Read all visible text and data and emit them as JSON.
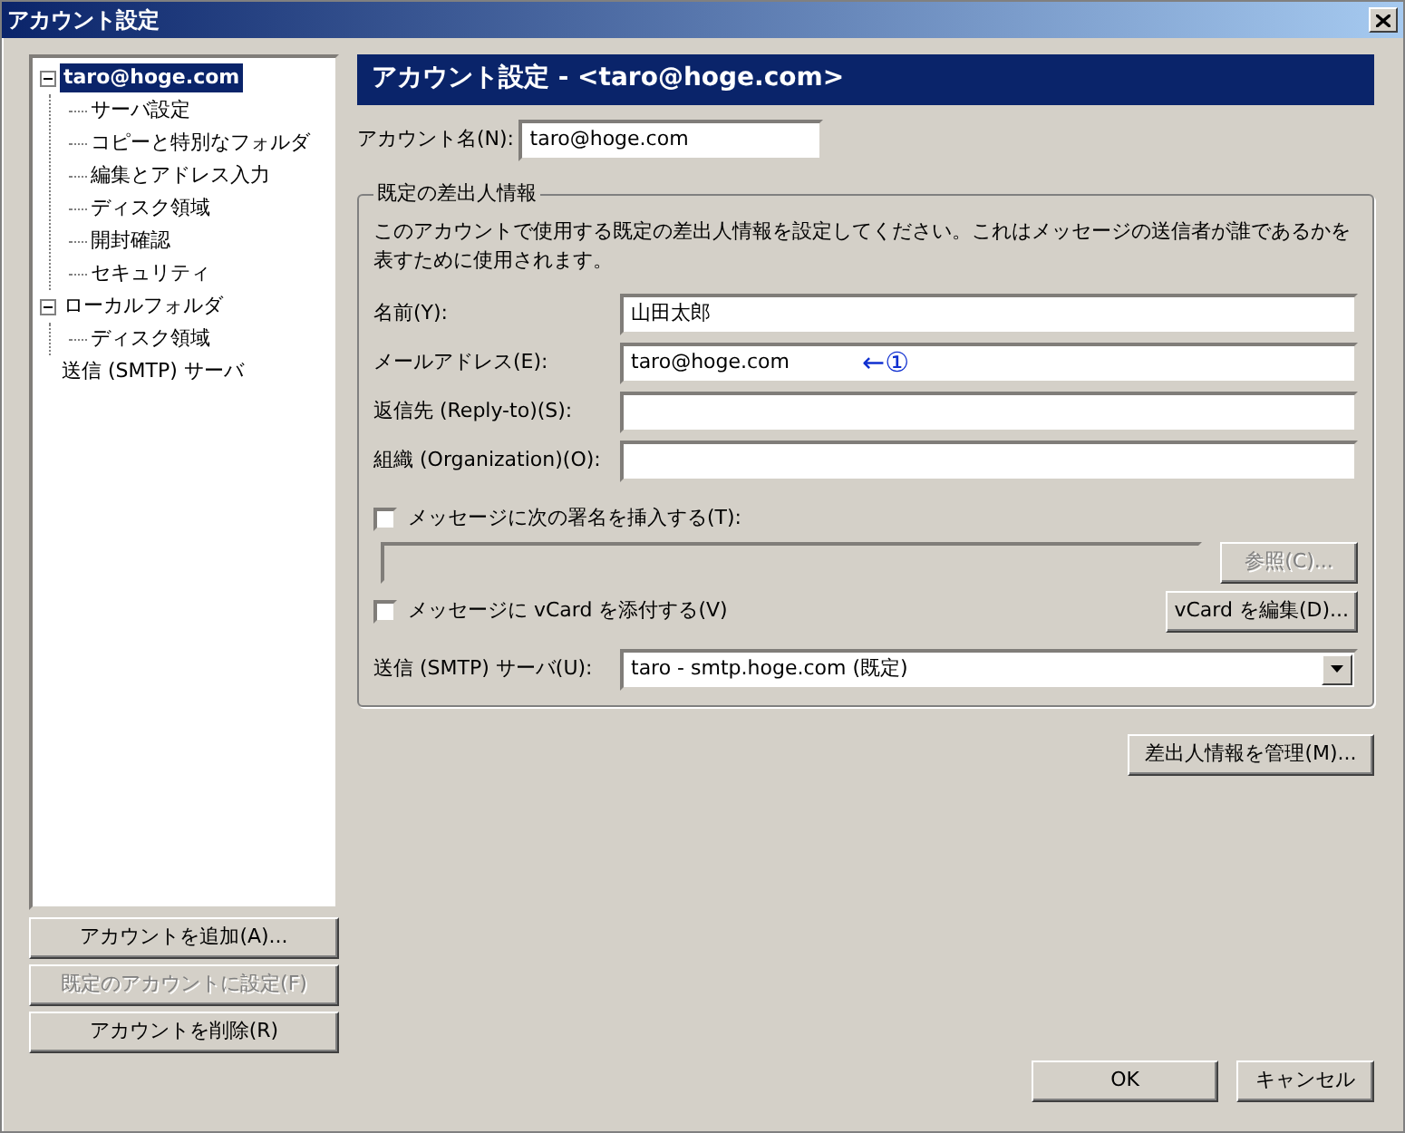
{
  "window": {
    "title": "アカウント設定"
  },
  "sidebar": {
    "tree": [
      {
        "label": "taro@hoge.com",
        "expanded": true,
        "selected": true,
        "children": [
          {
            "label": "サーバ設定",
            "selected": false
          },
          {
            "label": "コピーと特別なフォルダ",
            "selected": false
          },
          {
            "label": "編集とアドレス入力",
            "selected": false
          },
          {
            "label": "ディスク領域",
            "selected": false
          },
          {
            "label": "開封確認",
            "selected": false
          },
          {
            "label": "セキュリティ",
            "selected": false
          }
        ]
      },
      {
        "label": "ローカルフォルダ",
        "expanded": true,
        "selected": false,
        "children": [
          {
            "label": "ディスク領域",
            "selected": false
          }
        ]
      },
      {
        "label": "送信 (SMTP) サーバ",
        "selected": false
      }
    ],
    "buttons": [
      {
        "label": "アカウントを追加(A)...",
        "disabled": false
      },
      {
        "label": "既定のアカウントに設定(F)",
        "disabled": true
      },
      {
        "label": "アカウントを削除(R)",
        "disabled": false
      }
    ]
  },
  "panel": {
    "header": "アカウント設定 - <taro@hoge.com>",
    "account_name": {
      "label": "アカウント名(N):",
      "value": "taro@hoge.com"
    },
    "identity": {
      "title": "既定の差出人情報",
      "description": "このアカウントで使用する既定の差出人情報を設定してください。これはメッセージの送信者が誰であるかを表すために使用されます。",
      "fields": [
        {
          "label": "名前(Y):",
          "value": "山田太郎"
        },
        {
          "label": "メールアドレス(E):",
          "value": "taro@hoge.com",
          "annotation": "←①"
        },
        {
          "label": "返信先 (Reply-to)(S):"
        },
        {
          "label": "組織 (Organization)(O):"
        }
      ],
      "signature": {
        "label": "メッセージに次の署名を挿入する(T):",
        "checked": false,
        "path_disabled": true,
        "browse_button": {
          "label": "参照(C)...",
          "disabled": true
        }
      },
      "vcard": {
        "label": "メッセージに vCard を添付する(V)",
        "checked": false,
        "edit_button": "vCard を編集(D)..."
      },
      "smtp": {
        "label": "送信 (SMTP) サーバ(U):",
        "value": "taro - smtp.hoge.com (既定)"
      }
    },
    "manage_button": "差出人情報を管理(M)..."
  },
  "footer": {
    "buttons": [
      "OK",
      "キャンセル"
    ]
  }
}
